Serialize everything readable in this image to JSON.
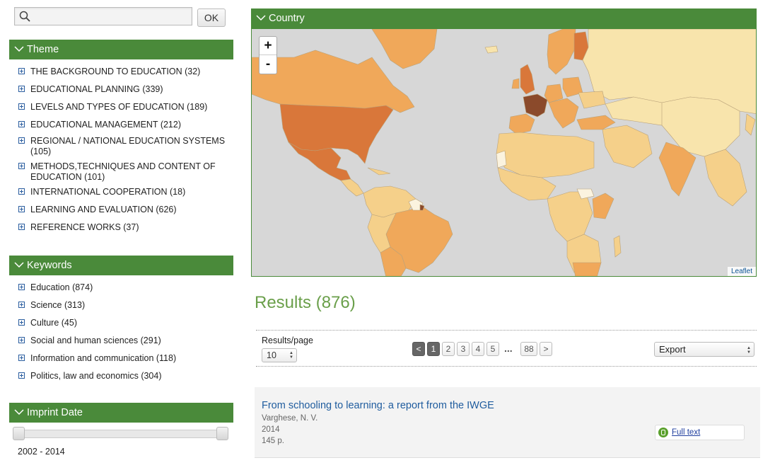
{
  "search": {
    "placeholder": "",
    "ok_label": "OK"
  },
  "theme": {
    "title": "Theme",
    "items": [
      {
        "label": "THE BACKGROUND TO EDUCATION (32)"
      },
      {
        "label": "EDUCATIONAL PLANNING (339)"
      },
      {
        "label": "LEVELS AND TYPES OF EDUCATION (189)"
      },
      {
        "label": "EDUCATIONAL MANAGEMENT (212)"
      },
      {
        "label": "REGIONAL / NATIONAL EDUCATION SYSTEMS (105)"
      },
      {
        "label": "METHODS,TECHNIQUES AND CONTENT OF EDUCATION (101)"
      },
      {
        "label": "INTERNATIONAL COOPERATION (18)"
      },
      {
        "label": "LEARNING AND EVALUATION (626)"
      },
      {
        "label": "REFERENCE WORKS (37)"
      }
    ]
  },
  "keywords": {
    "title": "Keywords",
    "items": [
      {
        "label": "Education (874)"
      },
      {
        "label": "Science (313)"
      },
      {
        "label": "Culture (45)"
      },
      {
        "label": "Social and human sciences (291)"
      },
      {
        "label": "Information and communication (118)"
      },
      {
        "label": "Politics, law and economics (304)"
      }
    ]
  },
  "imprint": {
    "title": "Imprint Date",
    "range": "2002 - 2014"
  },
  "country": {
    "title": "Country",
    "zoom_in": "+",
    "zoom_out": "-",
    "attribution": "Leaflet",
    "colors": {
      "highest": "#8b4a2b",
      "high": "#d9773a",
      "mid": "#f0a85a",
      "low": "#f5d08a",
      "lowest": "#f8e4ac",
      "sea": "#d7d7d7"
    }
  },
  "results": {
    "title": "Results (876)",
    "per_page_label": "Results/page",
    "per_page_value": "10",
    "pager": {
      "prev": "<",
      "pages": [
        "1",
        "2",
        "3",
        "4",
        "5"
      ],
      "ellipsis": "...",
      "last": "88",
      "next": ">"
    },
    "export_label": "Export",
    "items": [
      {
        "title": "From schooling to learning: a report from the IWGE",
        "author": "Varghese, N. V.",
        "year": "2014",
        "pages": "145 p.",
        "link": "Full text"
      }
    ]
  },
  "colors": {
    "panel_green": "#4a8a3a",
    "results_green": "#6a9f4a",
    "link_blue": "#1f5c9e"
  }
}
